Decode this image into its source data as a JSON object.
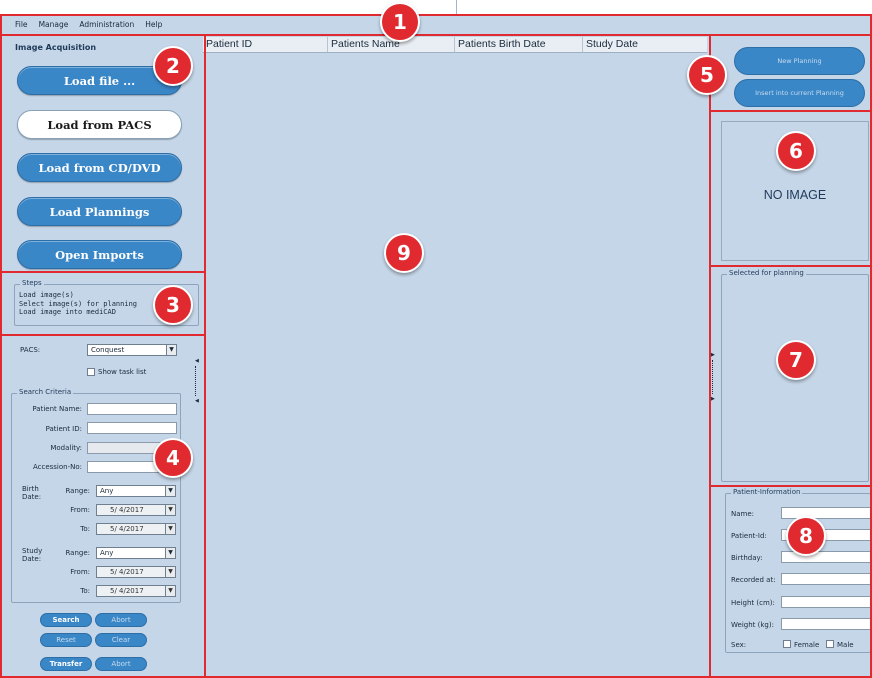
{
  "menu": [
    "File",
    "Manage",
    "Administration",
    "Help"
  ],
  "markers": [
    "1",
    "2",
    "3",
    "4",
    "5",
    "6",
    "7",
    "8",
    "9"
  ],
  "acquisition": {
    "title": "Image Acquisition",
    "buttons": [
      "Load file ...",
      "Load from PACS",
      "Load from CD/DVD",
      "Load Plannings",
      "Open Imports"
    ]
  },
  "steps": {
    "title": "Steps",
    "lines": [
      "Load image(s)",
      "Select image(s) for planning",
      "Load image into mediCAD"
    ]
  },
  "pacs": {
    "label": "PACS:",
    "value": "Conquest",
    "show_task_list": "Show task list",
    "search_criteria": "Search Criteria",
    "patient_name": "Patient Name:",
    "patient_id": "Patient ID:",
    "modality": "Modality:",
    "accession": "Accession-No:",
    "birth_date": "Birth Date:",
    "study_date": "Study Date:",
    "range": "Range:",
    "from": "From:",
    "to": "To:",
    "any": "Any",
    "date": "5/ 4/2017",
    "buttons": {
      "search": "Search",
      "abort": "Abort",
      "reset": "Reset",
      "clear": "Clear",
      "transfer": "Transfer",
      "abort2": "Abort"
    }
  },
  "table": {
    "columns": [
      "Patient ID",
      "Patients Name",
      "Patients Birth Date",
      "Study Date"
    ]
  },
  "planning": {
    "new": "New Planning",
    "insert": "Insert into current Planning"
  },
  "preview": {
    "text": "NO IMAGE"
  },
  "selected": {
    "title": "Selected for planning"
  },
  "patient_info": {
    "title": "Patient-Information",
    "name": "Name:",
    "patient_id": "Patient-Id:",
    "birthday": "Birthday:",
    "recorded_at": "Recorded at:",
    "height": "Height (cm):",
    "weight": "Weight (kg):",
    "sex": "Sex:",
    "female": "Female",
    "male": "Male"
  },
  "colors": {
    "accent": "#e02a2f",
    "button": "#3a87c8",
    "background": "#c5d6e8"
  }
}
